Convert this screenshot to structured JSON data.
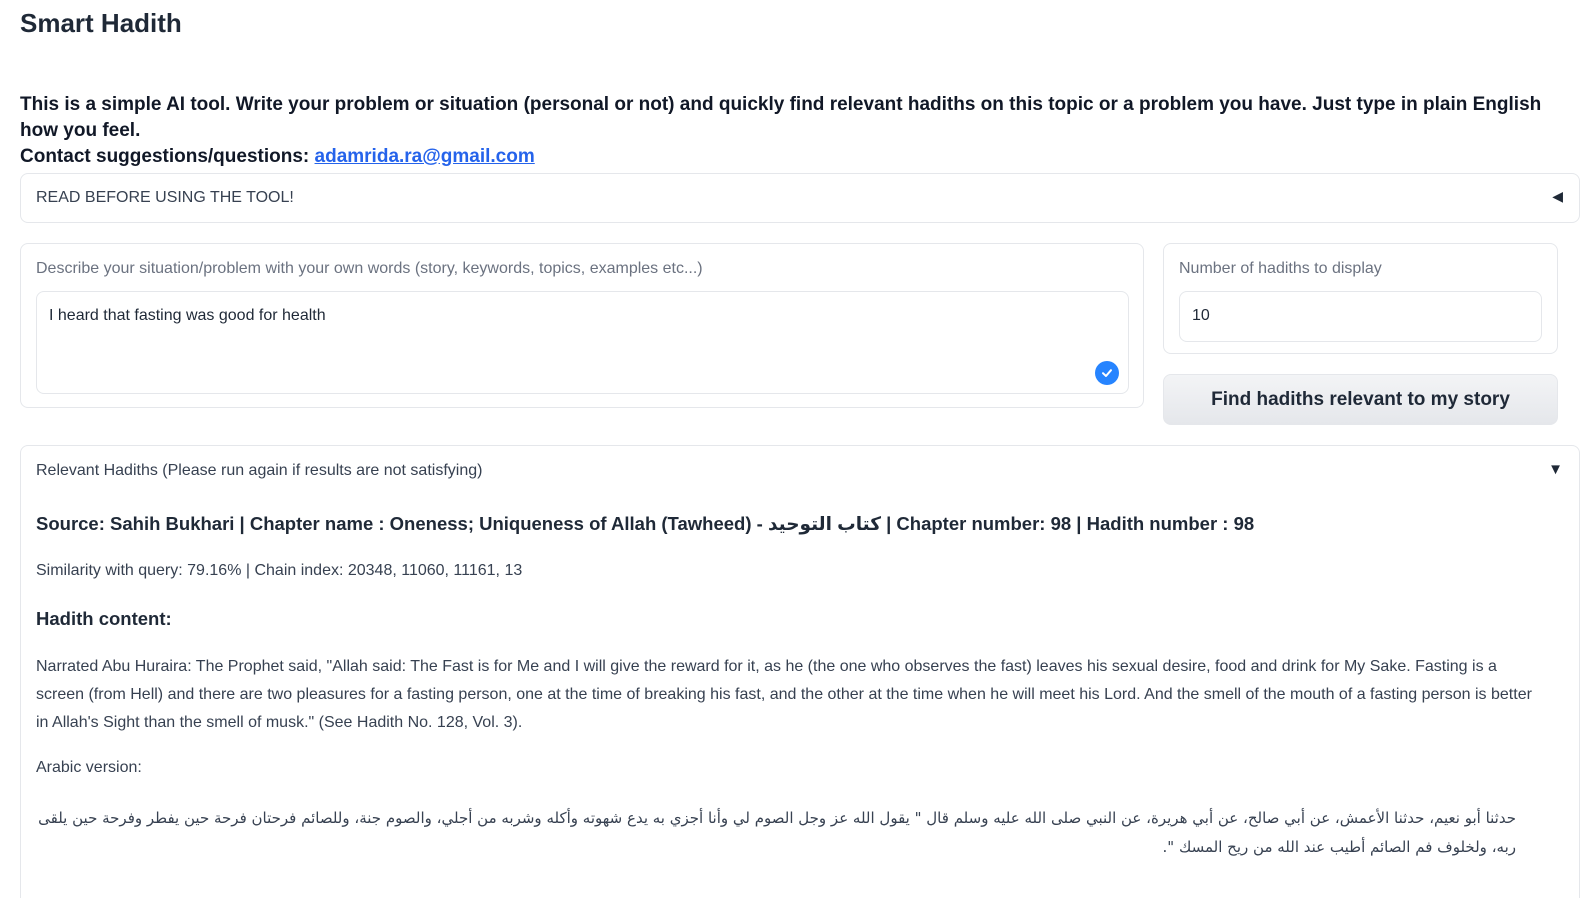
{
  "app": {
    "title": "Smart Hadith"
  },
  "intro": {
    "text": "This is a simple AI tool. Write your problem or situation (personal or not) and quickly find relevant hadiths on this topic or a problem you have. Just type in plain English how you feel.",
    "contact_prefix": "Contact suggestions/questions:",
    "email": "adamrida.ra@gmail.com"
  },
  "read_accordion": {
    "label": "READ BEFORE USING THE TOOL!",
    "icon": "triangle-left-icon"
  },
  "story": {
    "label": "Describe your situation/problem with your own words (story, keywords, topics, examples etc...)",
    "value": "I heard that fasting was good for health",
    "icon": "check-icon",
    "accent": "#2684ff"
  },
  "number": {
    "label": "Number of hadiths to display",
    "value": "10"
  },
  "find_button": {
    "label": "Find hadiths relevant to my story"
  },
  "results": {
    "label": "Relevant Hadiths (Please run again if results are not satisfying)",
    "icon": "triangle-down-icon",
    "items": [
      {
        "source": "Source: Sahih Bukhari | Chapter name : Oneness; Uniqueness of Allah (Tawheed) - كتاب التوحيد | Chapter number: 98 | Hadith number : 98",
        "similarity": "Similarity with query: 79.16% | Chain index: 20348, 11060, 11161, 13",
        "content_heading": "Hadith content:",
        "english": "Narrated Abu Huraira: The Prophet said, \"Allah said: The Fast is for Me and I will give the reward for it, as he (the one who observes the fast) leaves his sexual desire, food and drink for My Sake. Fasting is a screen (from Hell) and there are two pleasures for a fasting person, one at the time of breaking his fast, and the other at the time when he will meet his Lord. And the smell of the mouth of a fasting person is better in Allah's Sight than the smell of musk.\" (See Hadith No. 128, Vol. 3).",
        "arabic_label": "Arabic version:",
        "arabic": "حدثنا أبو نعيم، حدثنا الأعمش، عن أبي صالح، عن أبي هريرة، عن النبي صلى الله عليه وسلم قال \" يقول الله عز وجل الصوم لي وأنا أجزي به يدع شهوته وأكله وشربه من أجلي، والصوم جنة، وللصائم فرحتان فرحة حين يفطر وفرحة حين يلقى ربه، ولخلوف فم الصائم أطيب عند الله من ريح المسك \"."
      }
    ]
  }
}
